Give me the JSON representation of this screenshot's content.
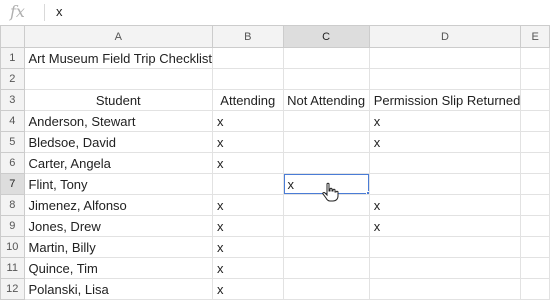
{
  "formula_bar": {
    "fx_label": "fx",
    "value": "x"
  },
  "columns": [
    "A",
    "B",
    "C",
    "D",
    "E"
  ],
  "selected_column": "C",
  "selected_row": "7",
  "rows": [
    {
      "num": "1",
      "a": "Art Museum Field Trip Checklist",
      "b": "",
      "c": "",
      "d": "",
      "e": ""
    },
    {
      "num": "2",
      "a": "",
      "b": "",
      "c": "",
      "d": "",
      "e": ""
    },
    {
      "num": "3",
      "a": "Student",
      "b": "Attending",
      "c": "Not Attending",
      "d": "Permission Slip Returned",
      "e": ""
    },
    {
      "num": "4",
      "a": "Anderson, Stewart",
      "b": "x",
      "c": "",
      "d": "x",
      "e": ""
    },
    {
      "num": "5",
      "a": "Bledsoe, David",
      "b": "x",
      "c": "",
      "d": "x",
      "e": ""
    },
    {
      "num": "6",
      "a": "Carter, Angela",
      "b": "x",
      "c": "",
      "d": "",
      "e": ""
    },
    {
      "num": "7",
      "a": "Flint, Tony",
      "b": "",
      "c": "x",
      "d": "",
      "e": ""
    },
    {
      "num": "8",
      "a": "Jimenez, Alfonso",
      "b": "x",
      "c": "",
      "d": "x",
      "e": ""
    },
    {
      "num": "9",
      "a": "Jones, Drew",
      "b": "x",
      "c": "",
      "d": "x",
      "e": ""
    },
    {
      "num": "10",
      "a": "Martin, Billy",
      "b": "x",
      "c": "",
      "d": "",
      "e": ""
    },
    {
      "num": "11",
      "a": "Quince, Tim",
      "b": "x",
      "c": "",
      "d": "",
      "e": ""
    },
    {
      "num": "12",
      "a": "Polanski, Lisa",
      "b": "x",
      "c": "",
      "d": "",
      "e": ""
    }
  ],
  "colors": {
    "selection": "#4a7cd6",
    "header_bg": "#f3f3f3",
    "header_selected_bg": "#dddddd"
  }
}
